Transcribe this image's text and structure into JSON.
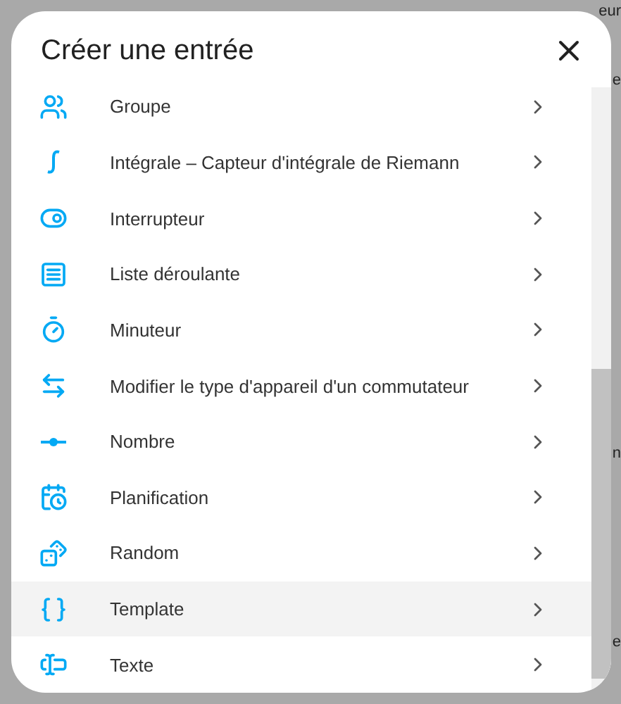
{
  "background": {
    "fragments": [
      {
        "text": "eur"
      },
      {
        "text": "e"
      },
      {
        "text": "n"
      },
      {
        "text": "e"
      }
    ]
  },
  "dialog": {
    "title": "Créer une entrée",
    "items": [
      {
        "label": "Groupe",
        "kind": "group",
        "hovered": false
      },
      {
        "label": "Intégrale – Capteur d'intégrale de Riemann",
        "kind": "integral",
        "hovered": false
      },
      {
        "label": "Interrupteur",
        "kind": "toggle",
        "hovered": false
      },
      {
        "label": "Liste déroulante",
        "kind": "dropdown",
        "hovered": false
      },
      {
        "label": "Minuteur",
        "kind": "timer",
        "hovered": false
      },
      {
        "label": "Modifier le type d'appareil d'un commutateur",
        "kind": "swap",
        "hovered": false
      },
      {
        "label": "Nombre",
        "kind": "number",
        "hovered": false
      },
      {
        "label": "Planification",
        "kind": "schedule",
        "hovered": false
      },
      {
        "label": "Random",
        "kind": "dice",
        "hovered": false
      },
      {
        "label": "Template",
        "kind": "braces",
        "hovered": true
      },
      {
        "label": "Texte",
        "kind": "text",
        "hovered": false
      }
    ]
  }
}
